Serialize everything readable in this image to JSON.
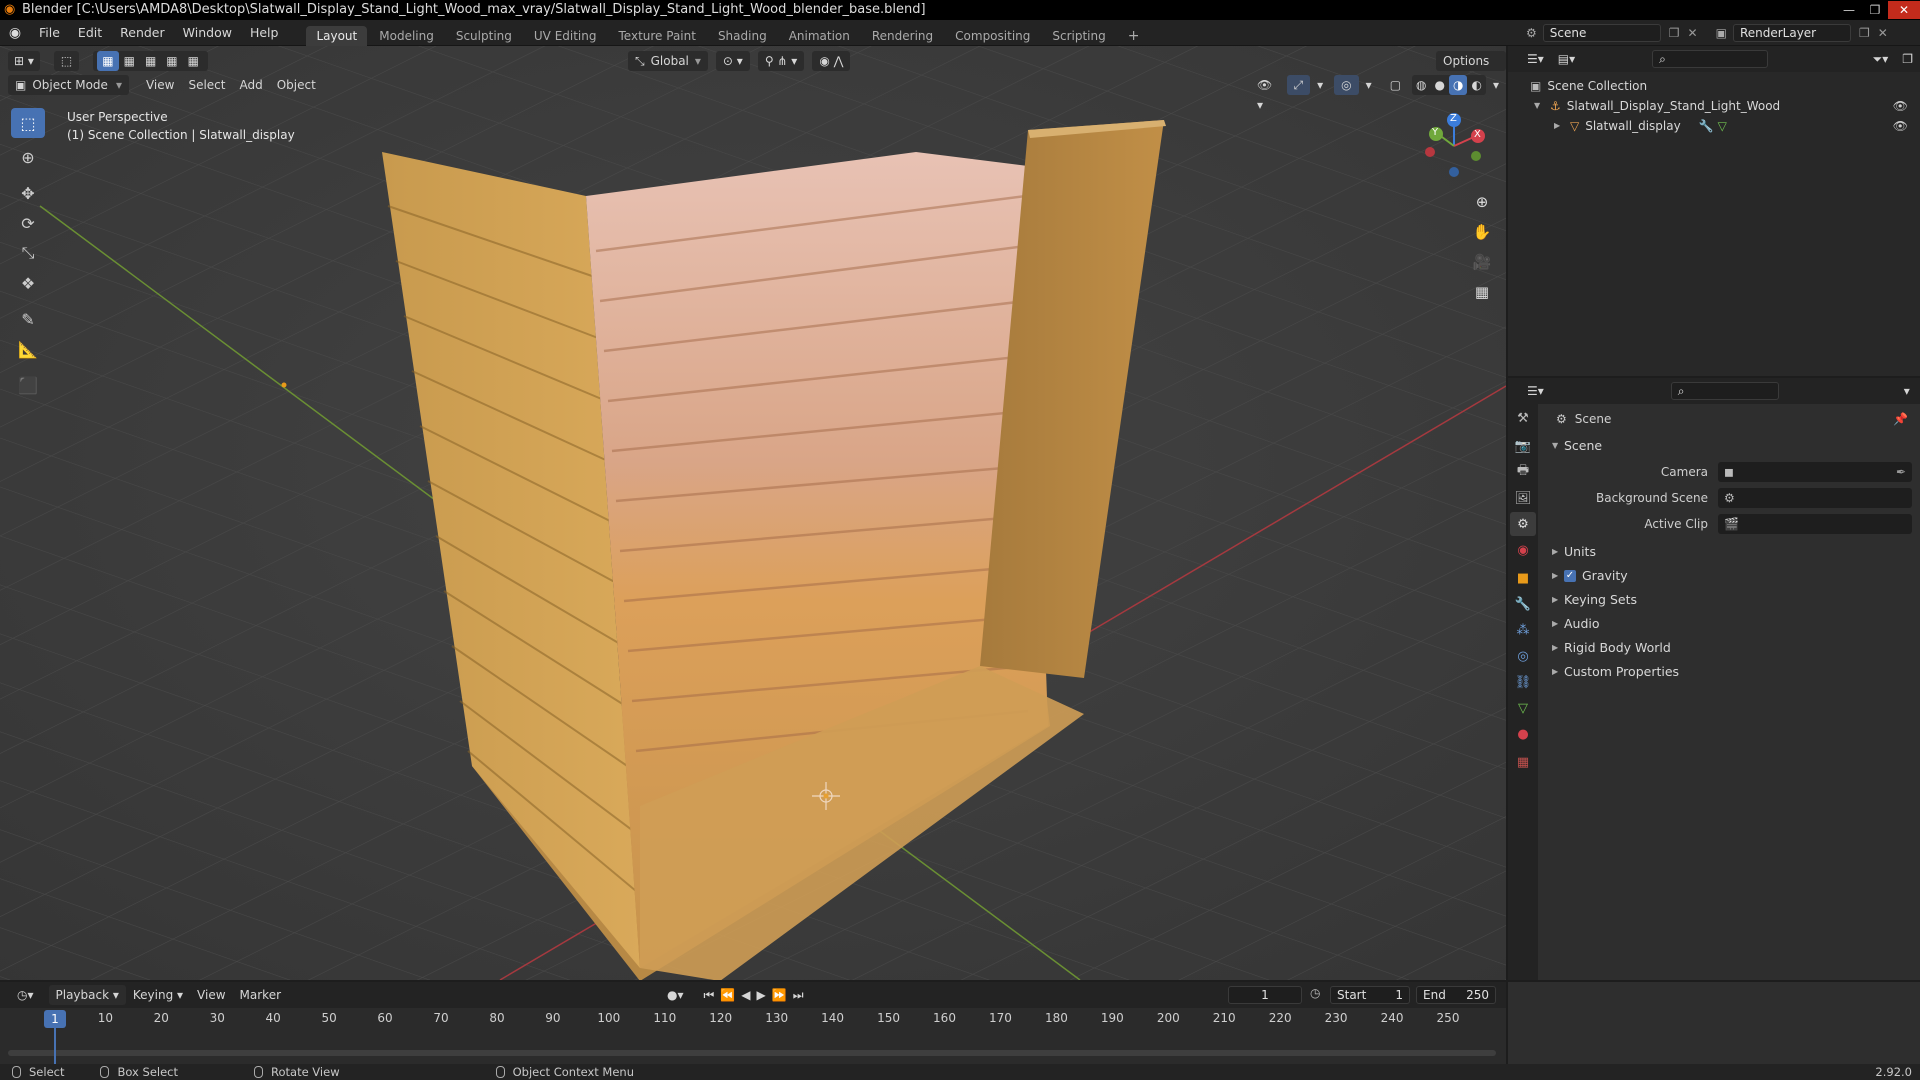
{
  "window": {
    "title": "Blender [C:\\Users\\AMDA8\\Desktop\\Slatwall_Display_Stand_Light_Wood_max_vray/Slatwall_Display_Stand_Light_Wood_blender_base.blend]",
    "minimize": "—",
    "maximize": "❐",
    "close": "✕"
  },
  "menus": [
    "File",
    "Edit",
    "Render",
    "Window",
    "Help"
  ],
  "workspaces": [
    "Layout",
    "Modeling",
    "Sculpting",
    "UV Editing",
    "Texture Paint",
    "Shading",
    "Animation",
    "Rendering",
    "Compositing",
    "Scripting"
  ],
  "workspace_add": "+",
  "scene_field": "Scene",
  "renderlayer_field": "RenderLayer",
  "viewport": {
    "transform_orientation": "Global",
    "options": "Options",
    "mode": "Object Mode",
    "menus": [
      "View",
      "Select",
      "Add",
      "Object"
    ],
    "overlay_line1": "User Perspective",
    "overlay_line2": "(1) Scene Collection | Slatwall_display",
    "axis_x": "X",
    "axis_y": "Y",
    "axis_z": "Z"
  },
  "outliner": {
    "root": "Scene Collection",
    "items": [
      "Slatwall_Display_Stand_Light_Wood",
      "Slatwall_display"
    ]
  },
  "properties": {
    "header": "Scene",
    "panel": "Scene",
    "rows": [
      {
        "label": "Camera",
        "value": ""
      },
      {
        "label": "Background Scene",
        "value": ""
      },
      {
        "label": "Active Clip",
        "value": ""
      }
    ],
    "sections": [
      "Units",
      "Gravity",
      "Keying Sets",
      "Audio",
      "Rigid Body World",
      "Custom Properties"
    ],
    "gravity_checked": true
  },
  "timeline": {
    "menus": [
      "Playback",
      "Keying",
      "View",
      "Marker"
    ],
    "current_frame": "1",
    "start_label": "Start",
    "start": "1",
    "end_label": "End",
    "end": "250",
    "ruler": [
      "1",
      "10",
      "20",
      "30",
      "40",
      "50",
      "60",
      "70",
      "80",
      "90",
      "100",
      "110",
      "120",
      "130",
      "140",
      "150",
      "160",
      "170",
      "180",
      "190",
      "200",
      "210",
      "220",
      "230",
      "240",
      "250"
    ]
  },
  "status": {
    "items": [
      "Select",
      "Box Select",
      "Rotate View",
      "Object Context Menu"
    ],
    "version": "2.92.0"
  },
  "colors": {
    "accent": "#4772b3",
    "x_axis": "#d4414c",
    "y_axis": "#70a83b",
    "z_axis": "#3b7ddc"
  }
}
